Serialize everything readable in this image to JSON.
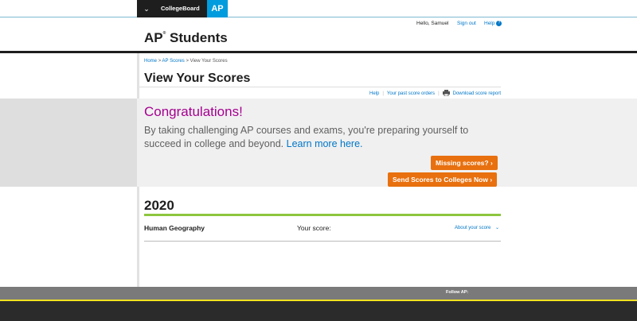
{
  "top_nav": {
    "menu_icon": "chevron-down-icon",
    "collegeboard_logo": "CollegeBoard",
    "ap_logo": "AP"
  },
  "utility": {
    "greeting": "Hello, Samuel",
    "sign_out": "Sign out",
    "help": "Help",
    "help_icon": "?"
  },
  "brand": {
    "ap": "AP",
    "registered": "®",
    "title": " Students"
  },
  "breadcrumb": {
    "home": "Home",
    "ap_scores": "AP Scores",
    "current": "View Your Scores",
    "separator": ">"
  },
  "page": {
    "title": "View Your Scores"
  },
  "subnav": {
    "help": "Help",
    "past_orders": "Your past score orders",
    "download": "Download score report",
    "divider": "|"
  },
  "banner": {
    "heading": "Congratulations!",
    "body": "By taking challenging AP courses and exams, you're preparing yourself to succeed in college and beyond.",
    "learn_more": "Learn more here.",
    "missing_scores_button": "Missing scores? ›",
    "send_scores_button": "Send Scores to Colleges Now ›"
  },
  "scores": {
    "year": "2020",
    "rows": [
      {
        "subject": "Human Geography",
        "score_label": "Your score:",
        "about": "About your score"
      }
    ]
  },
  "footer": {
    "follow": "Follow AP:"
  },
  "colors": {
    "ap_blue": "#009cde",
    "link_blue": "#0077c8",
    "congrats_magenta": "#a50090",
    "button_orange": "#e8700e",
    "year_green": "#8dc63f",
    "footer_yellow": "#f2e221"
  }
}
